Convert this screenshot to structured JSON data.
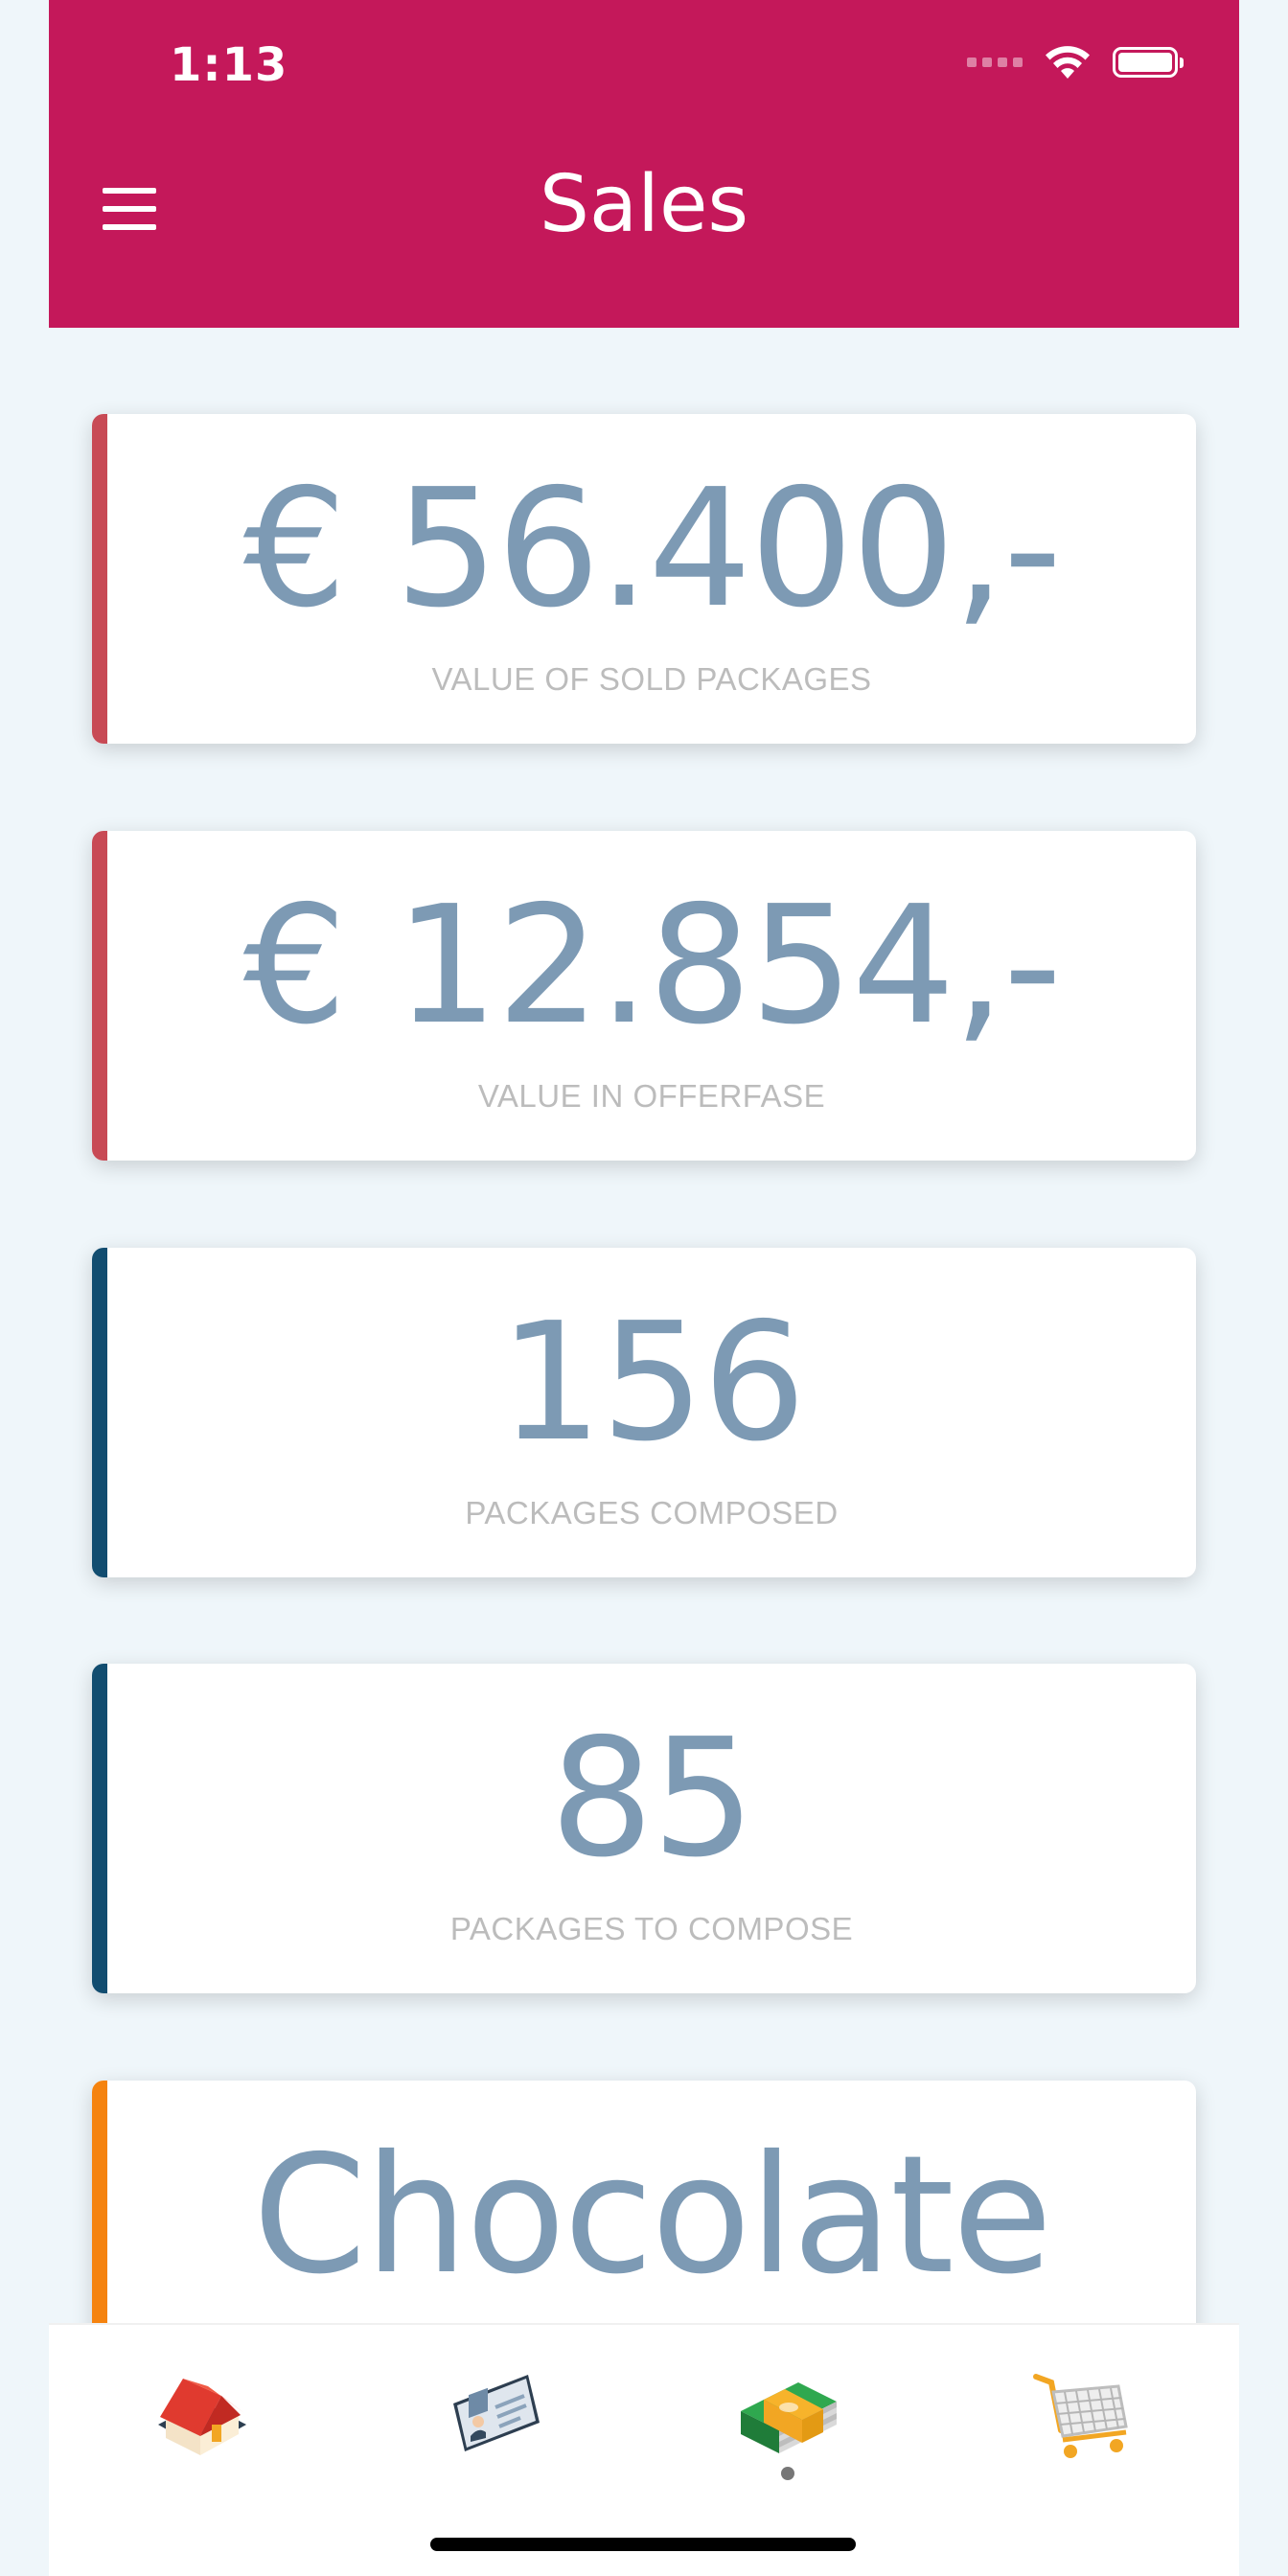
{
  "status_bar": {
    "time": "1:13",
    "icons": [
      "signal-dots-icon",
      "wifi-icon",
      "battery-icon"
    ]
  },
  "header": {
    "title": "Sales",
    "menu_icon": "hamburger-menu-icon",
    "background": "#c4185a"
  },
  "cards": [
    {
      "value": "€ 56.400,-",
      "label": "VALUE OF SOLD PACKAGES",
      "accent": "#c84a55"
    },
    {
      "value": "€ 12.854,-",
      "label": "VALUE IN OFFERFASE",
      "accent": "#c84a55"
    },
    {
      "value": "156",
      "label": "PACKAGES COMPOSED",
      "accent": "#124d70"
    },
    {
      "value": "85",
      "label": "PACKAGES TO COMPOSE",
      "accent": "#124d70"
    },
    {
      "value": "Chocolate",
      "label": "",
      "accent": "#f5830f"
    }
  ],
  "tabbar": {
    "tabs": [
      {
        "icon": "home-icon"
      },
      {
        "icon": "id-card-icon"
      },
      {
        "icon": "money-stack-icon",
        "active": true
      },
      {
        "icon": "shopping-cart-icon"
      }
    ]
  }
}
